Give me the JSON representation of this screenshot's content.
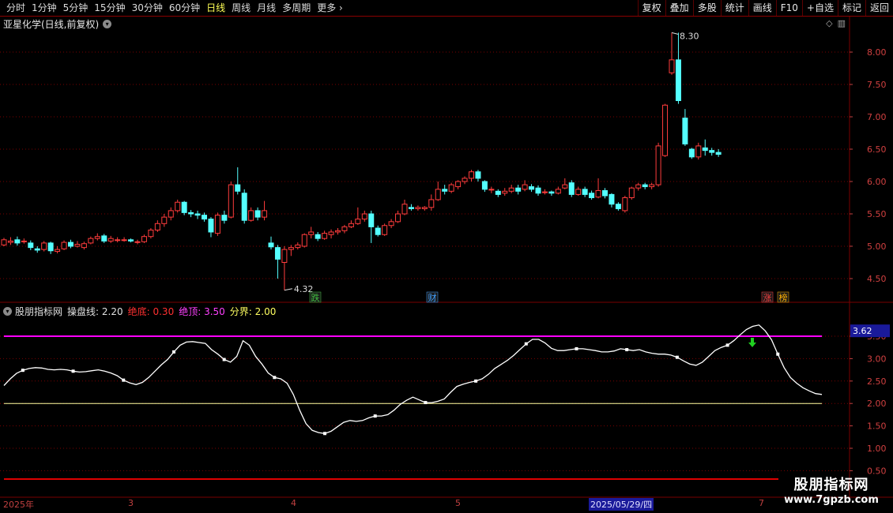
{
  "toolbar": {
    "periods": [
      "分时",
      "1分钟",
      "5分钟",
      "15分钟",
      "30分钟",
      "60分钟",
      "日线",
      "周线",
      "月线",
      "多周期",
      "更多"
    ],
    "active_period": "日线",
    "more_arrow": "›",
    "buttons": [
      "复权",
      "叠加",
      "多股",
      "统计",
      "画线",
      "F10",
      "+自选",
      "标记",
      "返回"
    ]
  },
  "price_panel": {
    "title": "亚星化学(日线,前复权)",
    "high_marker": "8.30",
    "low_marker": "4.32",
    "axis_ticks": [
      "8.00",
      "7.50",
      "7.00",
      "6.50",
      "6.00",
      "5.50",
      "5.00",
      "4.50"
    ],
    "tags": [
      {
        "text": "跌",
        "color": "#40c040"
      },
      {
        "text": "财",
        "color": "#40a0ff"
      },
      {
        "text": "涨",
        "color": "#ff4040"
      },
      {
        "text": "榜",
        "color": "#ffb000"
      }
    ]
  },
  "indicator": {
    "name": "股朋指标网",
    "items": [
      {
        "label": "操盘线:",
        "value": "2.20",
        "color": "#e0e0e0"
      },
      {
        "label": "绝底:",
        "value": "0.30",
        "color": "#ff3030"
      },
      {
        "label": "绝顶:",
        "value": "3.50",
        "color": "#ff40ff"
      },
      {
        "label": "分界:",
        "value": "2.00",
        "color": "#ffff60"
      }
    ],
    "current_value": "3.62",
    "axis_ticks": [
      "3.50",
      "3.00",
      "2.50",
      "2.00",
      "1.50",
      "1.00",
      "0.50"
    ]
  },
  "time_axis": {
    "labels": [
      "2025年",
      "3",
      "4",
      "5",
      "2025/05/29/四",
      "7"
    ],
    "highlight": "2025/05/29/四"
  },
  "watermark": {
    "line1": "股朋指标网",
    "line2": "www.7gpzb.com"
  },
  "colors": {
    "up": "#ff3c3c",
    "down": "#54ffff",
    "grid": "#7a0000",
    "line": "#ffffff",
    "top_line": "#ff00ff",
    "mid_line": "#ffffa0",
    "bottom_line": "#e00000"
  },
  "chart_data": {
    "type": "candlestick",
    "price_ylim": [
      4.2,
      8.4
    ],
    "indicator_ylim": [
      0.3,
      3.9
    ],
    "candles": [
      [
        5.02,
        5.1,
        5.13,
        5.0
      ],
      [
        5.06,
        5.08,
        5.14,
        5.02
      ],
      [
        5.1,
        5.05,
        5.15,
        5.01
      ],
      [
        5.08,
        5.08,
        5.12,
        5.04
      ],
      [
        5.05,
        4.98,
        5.09,
        4.94
      ],
      [
        4.96,
        4.94,
        5.0,
        4.9
      ],
      [
        4.95,
        5.05,
        5.08,
        4.92
      ],
      [
        5.05,
        4.93,
        5.07,
        4.88
      ],
      [
        4.92,
        4.95,
        5.0,
        4.89
      ],
      [
        4.96,
        5.06,
        5.09,
        4.94
      ],
      [
        5.06,
        5.0,
        5.1,
        4.97
      ],
      [
        5.0,
        5.03,
        5.08,
        4.98
      ],
      [
        4.98,
        5.04,
        5.07,
        4.95
      ],
      [
        5.05,
        5.12,
        5.15,
        5.03
      ],
      [
        5.12,
        5.15,
        5.2,
        5.09
      ],
      [
        5.16,
        5.08,
        5.19,
        5.05
      ],
      [
        5.08,
        5.12,
        5.16,
        5.05
      ],
      [
        5.1,
        5.1,
        5.14,
        5.06
      ],
      [
        5.1,
        5.1,
        5.14,
        5.07
      ],
      [
        5.1,
        5.08,
        5.12,
        5.06
      ],
      [
        5.06,
        5.07,
        5.1,
        5.03
      ],
      [
        5.07,
        5.15,
        5.18,
        5.05
      ],
      [
        5.15,
        5.25,
        5.28,
        5.12
      ],
      [
        5.25,
        5.35,
        5.4,
        5.22
      ],
      [
        5.35,
        5.45,
        5.5,
        5.3
      ],
      [
        5.45,
        5.55,
        5.6,
        5.4
      ],
      [
        5.55,
        5.68,
        5.72,
        5.52
      ],
      [
        5.68,
        5.52,
        5.7,
        5.48
      ],
      [
        5.52,
        5.5,
        5.56,
        5.45
      ],
      [
        5.5,
        5.48,
        5.55,
        5.42
      ],
      [
        5.48,
        5.42,
        5.52,
        5.38
      ],
      [
        5.42,
        5.22,
        5.45,
        5.14
      ],
      [
        5.2,
        5.48,
        5.52,
        5.16
      ],
      [
        5.48,
        5.4,
        5.55,
        5.35
      ],
      [
        5.45,
        5.95,
        6.0,
        5.43
      ],
      [
        5.95,
        5.85,
        6.22,
        5.8
      ],
      [
        5.82,
        5.4,
        5.88,
        5.35
      ],
      [
        5.4,
        5.55,
        5.6,
        5.38
      ],
      [
        5.55,
        5.45,
        5.6,
        5.4
      ],
      [
        5.45,
        5.55,
        5.7,
        5.4
      ],
      [
        5.05,
        4.99,
        5.15,
        4.95
      ],
      [
        4.98,
        4.8,
        5.02,
        4.5
      ],
      [
        4.75,
        4.95,
        5.0,
        4.32
      ],
      [
        4.95,
        4.98,
        5.02,
        4.85
      ],
      [
        4.98,
        5.02,
        5.06,
        4.95
      ],
      [
        5.0,
        5.18,
        5.2,
        4.98
      ],
      [
        5.18,
        5.22,
        5.3,
        5.12
      ],
      [
        5.18,
        5.12,
        5.22,
        5.08
      ],
      [
        5.12,
        5.2,
        5.24,
        5.1
      ],
      [
        5.18,
        5.22,
        5.26,
        5.12
      ],
      [
        5.22,
        5.24,
        5.28,
        5.18
      ],
      [
        5.24,
        5.3,
        5.33,
        5.2
      ],
      [
        5.3,
        5.35,
        5.4,
        5.28
      ],
      [
        5.35,
        5.42,
        5.6,
        5.33
      ],
      [
        5.42,
        5.5,
        5.55,
        5.38
      ],
      [
        5.5,
        5.3,
        5.55,
        5.05
      ],
      [
        5.28,
        5.18,
        5.32,
        5.15
      ],
      [
        5.18,
        5.32,
        5.35,
        5.16
      ],
      [
        5.32,
        5.38,
        5.42,
        5.28
      ],
      [
        5.38,
        5.5,
        5.55,
        5.36
      ],
      [
        5.5,
        5.65,
        5.72,
        5.48
      ],
      [
        5.6,
        5.58,
        5.65,
        5.55
      ],
      [
        5.58,
        5.6,
        5.63,
        5.55
      ],
      [
        5.58,
        5.6,
        5.62,
        5.55
      ],
      [
        5.6,
        5.72,
        5.8,
        5.55
      ],
      [
        5.72,
        5.88,
        6.0,
        5.7
      ],
      [
        5.88,
        5.85,
        5.95,
        5.8
      ],
      [
        5.85,
        5.95,
        5.98,
        5.82
      ],
      [
        5.92,
        6.0,
        6.02,
        5.88
      ],
      [
        6.0,
        6.05,
        6.08,
        5.96
      ],
      [
        6.05,
        6.15,
        6.18,
        6.0
      ],
      [
        6.15,
        6.05,
        6.18,
        6.0
      ],
      [
        6.0,
        5.88,
        6.02,
        5.84
      ],
      [
        5.88,
        5.88,
        5.92,
        5.82
      ],
      [
        5.85,
        5.8,
        5.88,
        5.76
      ],
      [
        5.82,
        5.85,
        5.9,
        5.78
      ],
      [
        5.85,
        5.9,
        5.95,
        5.82
      ],
      [
        5.9,
        5.85,
        5.95,
        5.8
      ],
      [
        5.88,
        5.95,
        6.02,
        5.85
      ],
      [
        5.92,
        5.88,
        5.96,
        5.84
      ],
      [
        5.9,
        5.82,
        5.94,
        5.78
      ],
      [
        5.84,
        5.84,
        5.88,
        5.8
      ],
      [
        5.84,
        5.82,
        5.86,
        5.78
      ],
      [
        5.82,
        5.88,
        5.92,
        5.8
      ],
      [
        5.9,
        5.95,
        6.05,
        5.88
      ],
      [
        5.98,
        5.8,
        6.02,
        5.76
      ],
      [
        5.8,
        5.88,
        5.92,
        5.78
      ],
      [
        5.88,
        5.8,
        5.92,
        5.76
      ],
      [
        5.82,
        5.75,
        5.86,
        5.72
      ],
      [
        5.76,
        5.86,
        6.05,
        5.74
      ],
      [
        5.86,
        5.78,
        5.9,
        5.74
      ],
      [
        5.8,
        5.65,
        5.82,
        5.6
      ],
      [
        5.65,
        5.58,
        5.68,
        5.55
      ],
      [
        5.55,
        5.75,
        5.78,
        5.52
      ],
      [
        5.75,
        5.9,
        5.92,
        5.72
      ],
      [
        5.9,
        5.95,
        5.98,
        5.86
      ],
      [
        5.95,
        5.92,
        5.98,
        5.88
      ],
      [
        5.92,
        5.95,
        5.98,
        5.88
      ],
      [
        5.95,
        6.55,
        6.6,
        5.92
      ],
      [
        6.4,
        7.18,
        7.2,
        6.38
      ],
      [
        7.68,
        7.88,
        8.3,
        7.65
      ],
      [
        7.88,
        7.25,
        8.3,
        7.2
      ],
      [
        6.98,
        6.58,
        7.12,
        6.55
      ],
      [
        6.5,
        6.38,
        6.52,
        6.35
      ],
      [
        6.38,
        6.55,
        6.6,
        6.34
      ],
      [
        6.52,
        6.48,
        6.65,
        6.4
      ],
      [
        6.48,
        6.45,
        6.52,
        6.4
      ],
      [
        6.45,
        6.42,
        6.5,
        6.38
      ]
    ],
    "indicator_line": [
      2.4,
      2.55,
      2.67,
      2.74,
      2.78,
      2.8,
      2.79,
      2.76,
      2.75,
      2.76,
      2.75,
      2.72,
      2.7,
      2.71,
      2.73,
      2.75,
      2.72,
      2.68,
      2.62,
      2.52,
      2.46,
      2.42,
      2.47,
      2.58,
      2.72,
      2.86,
      2.98,
      3.15,
      3.3,
      3.37,
      3.38,
      3.36,
      3.34,
      3.2,
      3.1,
      2.98,
      2.92,
      3.05,
      3.4,
      3.3,
      3.05,
      2.88,
      2.68,
      2.58,
      2.55,
      2.45,
      2.2,
      1.85,
      1.55,
      1.4,
      1.35,
      1.33,
      1.38,
      1.48,
      1.58,
      1.62,
      1.6,
      1.62,
      1.68,
      1.72,
      1.72,
      1.75,
      1.85,
      1.98,
      2.07,
      2.14,
      2.08,
      2.02,
      2.02,
      2.05,
      2.1,
      2.25,
      2.38,
      2.43,
      2.47,
      2.5,
      2.55,
      2.65,
      2.78,
      2.87,
      2.96,
      3.07,
      3.2,
      3.33,
      3.43,
      3.43,
      3.35,
      3.23,
      3.18,
      3.18,
      3.2,
      3.22,
      3.22,
      3.2,
      3.18,
      3.15,
      3.15,
      3.17,
      3.22,
      3.2,
      3.18,
      3.2,
      3.15,
      3.12,
      3.1,
      3.1,
      3.08,
      3.03,
      2.95,
      2.88,
      2.85,
      2.92,
      3.05,
      3.18,
      3.25,
      3.3,
      3.4,
      3.53,
      3.65,
      3.72,
      3.75,
      3.62,
      3.42,
      3.1,
      2.8,
      2.58,
      2.45,
      2.35,
      2.28,
      2.22,
      2.2
    ]
  }
}
